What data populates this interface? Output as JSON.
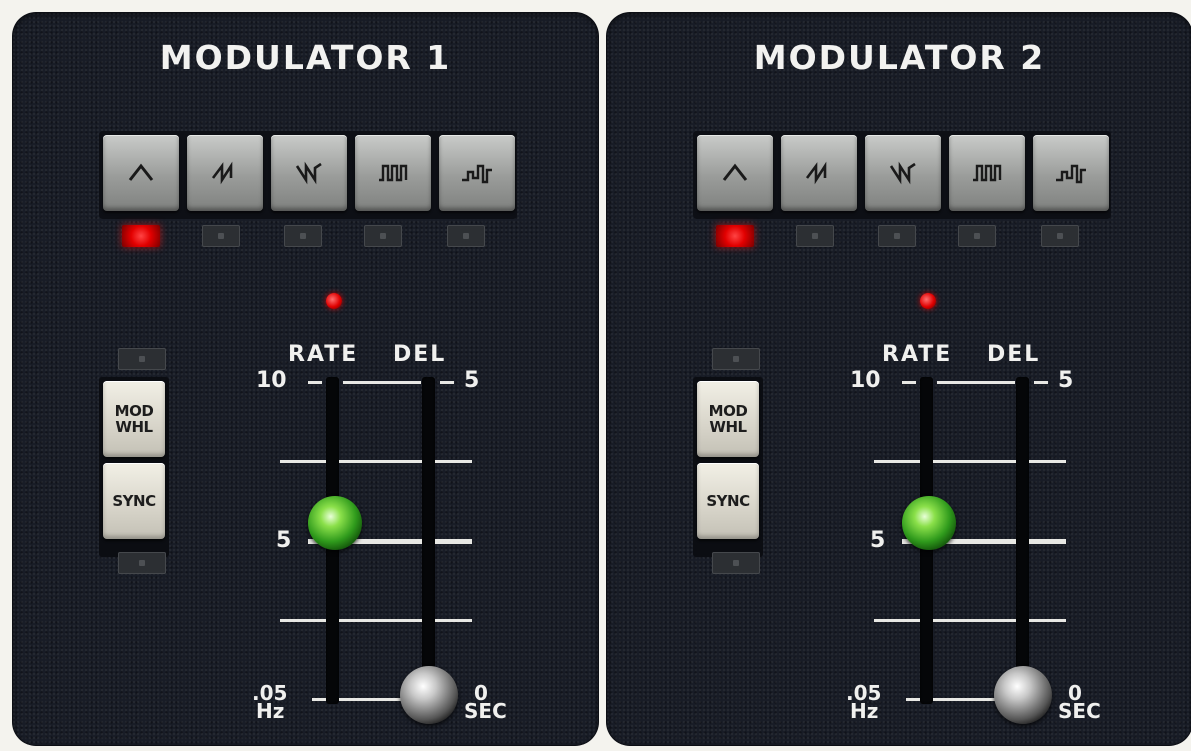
{
  "modulators": [
    {
      "title": "MODULATOR 1",
      "waveforms": [
        {
          "icon": "triangle-wave-icon",
          "active": true
        },
        {
          "icon": "sawtooth-wave-icon",
          "active": false
        },
        {
          "icon": "ramp-wave-icon",
          "active": false
        },
        {
          "icon": "square-wave-icon",
          "active": false
        },
        {
          "icon": "random-step-wave-icon",
          "active": false
        }
      ],
      "mod_whl_label": "MOD\nWHL",
      "sync_label": "SYNC",
      "rate_label": "RATE",
      "del_label": "DEL",
      "rate_scale": {
        "top": "10",
        "mid": "5",
        "bottom": ".05",
        "unit": "Hz"
      },
      "del_scale": {
        "top": "5",
        "bottom": "0",
        "unit": "SEC"
      },
      "rate_value": 5,
      "delay_value": 0
    },
    {
      "title": "MODULATOR 2",
      "waveforms": [
        {
          "icon": "triangle-wave-icon",
          "active": true
        },
        {
          "icon": "sawtooth-wave-icon",
          "active": false
        },
        {
          "icon": "ramp-wave-icon",
          "active": false
        },
        {
          "icon": "square-wave-icon",
          "active": false
        },
        {
          "icon": "random-step-wave-icon",
          "active": false
        }
      ],
      "mod_whl_label": "MOD\nWHL",
      "sync_label": "SYNC",
      "rate_label": "RATE",
      "del_label": "DEL",
      "rate_scale": {
        "top": "10",
        "mid": "5",
        "bottom": ".05",
        "unit": "Hz"
      },
      "del_scale": {
        "top": "5",
        "bottom": "0",
        "unit": "SEC"
      },
      "rate_value": 5,
      "delay_value": 0
    }
  ],
  "colors": {
    "panel": "#181c26",
    "led_on": "#e20000",
    "knob_green": "#2f9a1c",
    "label": "#f0f0ee"
  }
}
